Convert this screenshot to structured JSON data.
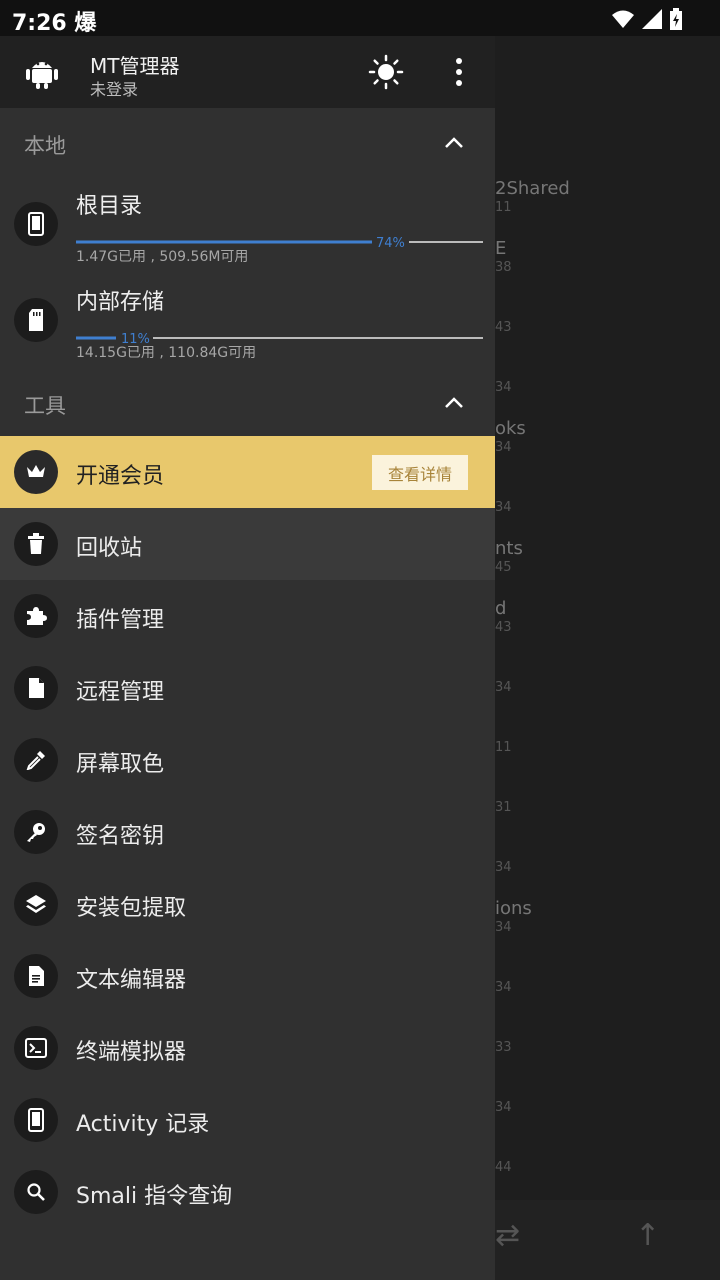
{
  "status_bar": {
    "time": "7:26 爆"
  },
  "drawer": {
    "app_title": "MT管理器",
    "app_subtitle": "未登录",
    "sections": {
      "local": "本地",
      "tools": "工具"
    },
    "storage": [
      {
        "name": "根目录",
        "usage_percent": 74,
        "percent_label": "74%",
        "info": "1.47G已用 , 509.56M可用"
      },
      {
        "name": "内部存储",
        "usage_percent": 11,
        "percent_label": "11%",
        "info": "14.15G已用 , 110.84G可用"
      }
    ],
    "vip": {
      "label": "开通会员",
      "button": "查看详情"
    },
    "tools": [
      {
        "label": "回收站",
        "icon": "trash-icon"
      },
      {
        "label": "插件管理",
        "icon": "puzzle-icon"
      },
      {
        "label": "远程管理",
        "icon": "file-icon"
      },
      {
        "label": "屏幕取色",
        "icon": "eyedropper-icon"
      },
      {
        "label": "签名密钥",
        "icon": "key-icon"
      },
      {
        "label": "安装包提取",
        "icon": "layers-icon"
      },
      {
        "label": "文本编辑器",
        "icon": "document-icon"
      },
      {
        "label": "终端模拟器",
        "icon": "terminal-icon"
      },
      {
        "label": "Activity 记录",
        "icon": "phone-icon"
      },
      {
        "label": "Smali 指令查询",
        "icon": "search-icon"
      }
    ]
  },
  "background": {
    "items": [
      {
        "title": "2Shared",
        "sub": "11"
      },
      {
        "title": "E",
        "sub": "38"
      },
      {
        "title": "",
        "sub": "43"
      },
      {
        "title": "",
        "sub": "34"
      },
      {
        "title": "oks",
        "sub": "34"
      },
      {
        "title": "",
        "sub": "34"
      },
      {
        "title": "nts",
        "sub": "45"
      },
      {
        "title": "d",
        "sub": "43"
      },
      {
        "title": "",
        "sub": "34"
      },
      {
        "title": "",
        "sub": "11"
      },
      {
        "title": "",
        "sub": "31"
      },
      {
        "title": "",
        "sub": "34"
      },
      {
        "title": "ions",
        "sub": "34"
      },
      {
        "title": "",
        "sub": "34"
      },
      {
        "title": "",
        "sub": "33"
      },
      {
        "title": "",
        "sub": "34"
      },
      {
        "title": "",
        "sub": "44"
      }
    ]
  },
  "colors": {
    "accent": "#3f7fd0",
    "vip": "#e8c86c",
    "drawer_bg": "#303030"
  }
}
